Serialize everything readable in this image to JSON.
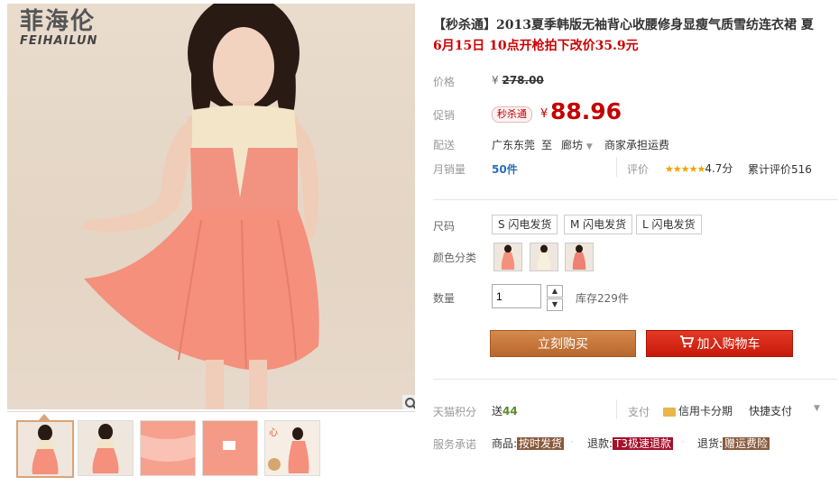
{
  "brand": {
    "cn": "菲海伦",
    "en": "FEIHAILUN"
  },
  "title": "【秒杀通】2013夏季韩版无袖背心收腰修身显瘦气质雪纺连衣裙 夏",
  "subtitle": "6月15日 10点开枪拍下改价35.9元",
  "price": {
    "label": "价格",
    "currency": "¥",
    "original": "278.00"
  },
  "promo": {
    "label": "促销",
    "badge": "秒杀通",
    "currency": "¥",
    "price": "88.96"
  },
  "shipping": {
    "label": "配送",
    "from": "广东东莞",
    "to_word": "至",
    "to": "廊坊",
    "fee": "商家承担运费"
  },
  "sales": {
    "label": "月销量",
    "value": "50件",
    "rating_label": "评价",
    "stars": "★★★★★",
    "score": "4.7分",
    "reviews": "累计评价516"
  },
  "size": {
    "label": "尺码",
    "options": [
      "S 闪电发货",
      "M 闪电发货",
      "L 闪电发货"
    ]
  },
  "color": {
    "label": "颜色分类"
  },
  "quantity": {
    "label": "数量",
    "value": "1",
    "stock": "库存229件"
  },
  "buttons": {
    "buy": "立刻购买",
    "cart": "加入购物车"
  },
  "points": {
    "label": "天猫积分",
    "send": "送",
    "value": "44",
    "pay_label": "支付",
    "credit": "信用卡分期",
    "quick": "快捷支付"
  },
  "promise": {
    "label": "服务承诺",
    "goods": "商品:",
    "goods_tag": "按时发货",
    "refund": "退款:",
    "refund_tag": "T3极速退款",
    "return": "退货:",
    "return_tag": "赠运费险"
  },
  "colors": {
    "price_red": "#c40000",
    "buy_btn": "#c57a3d",
    "cart_btn": "#d62a17"
  }
}
